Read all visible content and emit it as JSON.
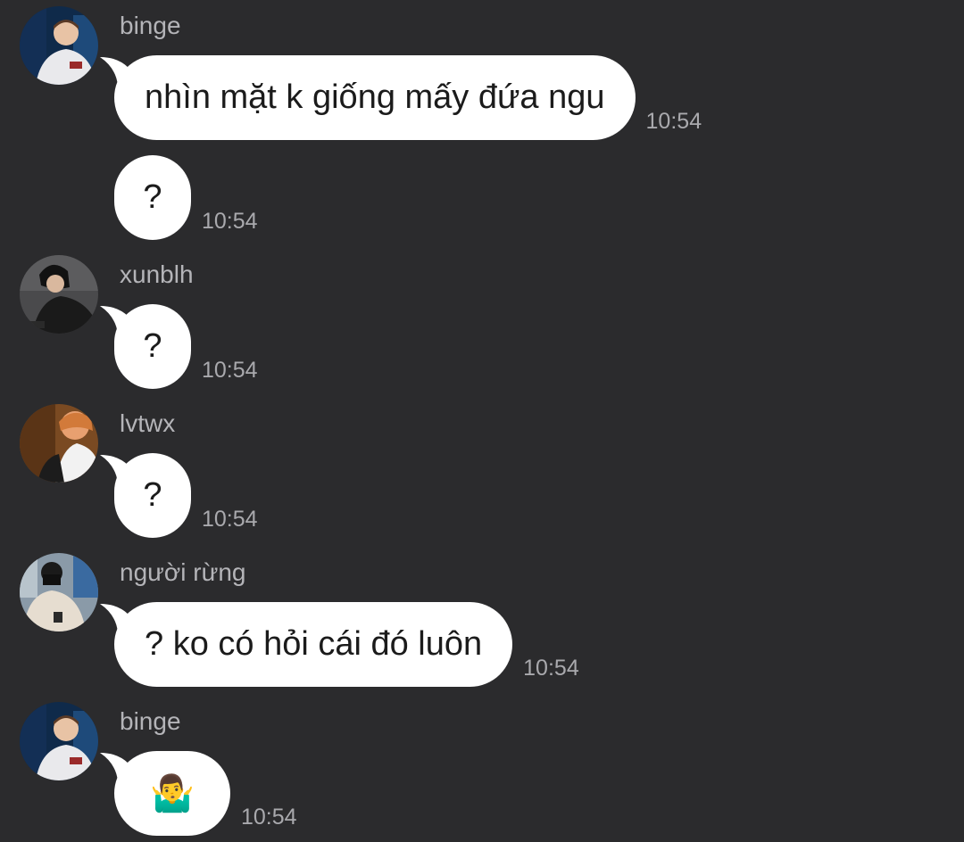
{
  "messages": [
    {
      "sender": "binge",
      "avatar_icon": "avatar-binge",
      "text": "nhìn mặt k giống mấy đứa ngu",
      "time": "10:54"
    },
    {
      "sender": "",
      "text": "?",
      "time": "10:54"
    },
    {
      "sender": "xunblh",
      "avatar_icon": "avatar-xunblh",
      "text": "?",
      "time": "10:54"
    },
    {
      "sender": "lvtwx",
      "avatar_icon": "avatar-lvtwx",
      "text": "?",
      "time": "10:54"
    },
    {
      "sender": "người rừng",
      "avatar_icon": "avatar-nguoi-rung",
      "text": "? ko có hỏi cái đó luôn",
      "time": "10:54"
    },
    {
      "sender": "binge",
      "avatar_icon": "avatar-binge",
      "text": "🤷‍♂️",
      "time": "10:54"
    }
  ],
  "colors": {
    "background": "#2b2b2d",
    "bubble": "#ffffff",
    "sender_text": "#b4b4b8",
    "timestamp": "#a9a9ad",
    "message_text": "#1b1b1b"
  }
}
